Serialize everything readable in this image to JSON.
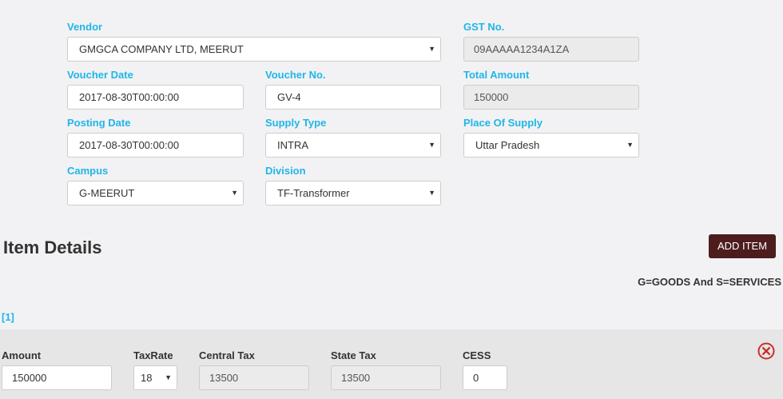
{
  "voucher": {
    "vendor": {
      "label": "Vendor",
      "value": "GMGCA COMPANY LTD, MEERUT"
    },
    "gst": {
      "label": "GST No.",
      "value": "09AAAAA1234A1ZA"
    },
    "voucher_date": {
      "label": "Voucher Date",
      "value": "2017-08-30T00:00:00"
    },
    "voucher_no": {
      "label": "Voucher No.",
      "value": "GV-4"
    },
    "total_amount": {
      "label": "Total Amount",
      "value": "150000"
    },
    "posting_date": {
      "label": "Posting Date",
      "value": "2017-08-30T00:00:00"
    },
    "supply_type": {
      "label": "Supply Type",
      "value": "INTRA"
    },
    "place_of_supply": {
      "label": "Place Of Supply",
      "value": "Uttar Pradesh"
    },
    "campus": {
      "label": "Campus",
      "value": "G-MEERUT"
    },
    "division": {
      "label": "Division",
      "value": "TF-Transformer"
    }
  },
  "items": {
    "title": "Item Details",
    "add_label": "ADD ITEM",
    "legend": "G=GOODS And S=SERVICES",
    "index_label": "[1]",
    "row": {
      "amount": {
        "label": "Amount",
        "value": "150000"
      },
      "tax_rate": {
        "label": "TaxRate",
        "value": "18"
      },
      "central_tax": {
        "label": "Central Tax",
        "value": "13500"
      },
      "state_tax": {
        "label": "State Tax",
        "value": "13500"
      },
      "cess": {
        "label": "CESS",
        "value": "0"
      }
    }
  },
  "icons": {
    "caret": "caret-down-icon",
    "remove": "remove-circle-icon"
  },
  "colors": {
    "label_accent": "#1fb6e8",
    "button_bg": "#4d1d1d",
    "remove_icon": "#c9302c"
  }
}
